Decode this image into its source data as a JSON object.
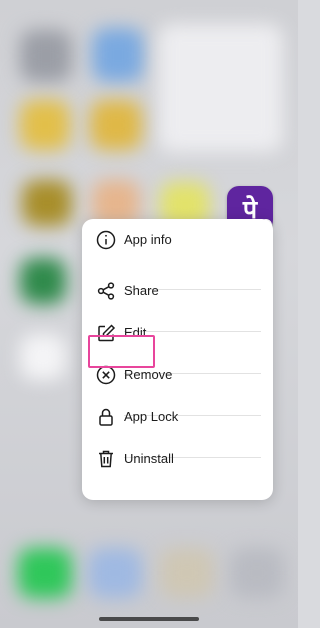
{
  "app": {
    "icon_glyph": "पे",
    "brand_color": "#5f259f"
  },
  "menu": {
    "items": [
      {
        "label": "App info",
        "icon": "info-icon"
      },
      {
        "label": "Share",
        "icon": "share-icon"
      },
      {
        "label": "Edit",
        "icon": "edit-icon",
        "highlighted": true
      },
      {
        "label": "Remove",
        "icon": "remove-icon"
      },
      {
        "label": "App Lock",
        "icon": "lock-icon"
      },
      {
        "label": "Uninstall",
        "icon": "trash-icon"
      }
    ],
    "highlight_color": "#e8459c"
  }
}
